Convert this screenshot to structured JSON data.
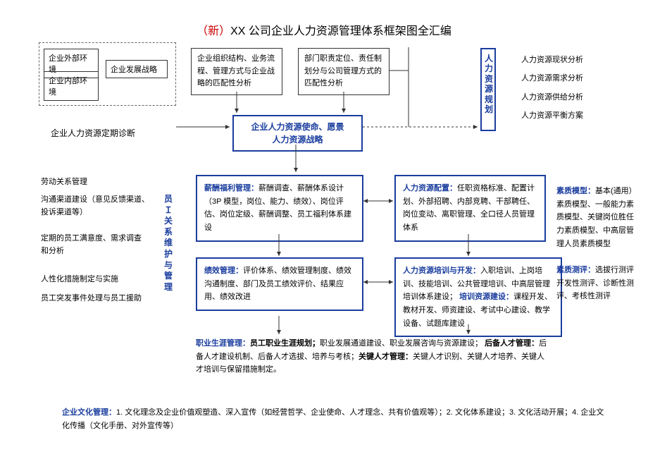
{
  "title": {
    "prefix": "（新）",
    "main": "XX 公司企业人力资源管理体系框架图全汇编"
  },
  "env": {
    "ext": "企业外部环境",
    "int": "企业内部环境",
    "strat": "企业发展战略"
  },
  "top": {
    "b1": "企业组织结构、业务流程、管理方式与企业战略的匹配性分析",
    "b2": "部门职责定位、责任制划分与公司管理方式的匹配性分析"
  },
  "center": {
    "l1": "企业人力资源使命、愿景",
    "l2": "人力资源战略"
  },
  "plan": "人力资源规划",
  "rightList": {
    "a": "人力资源现状分析",
    "b": "人力资源需求分析",
    "c": "人力资源供给分析",
    "d": "人力资源平衡方案"
  },
  "diag": "企业人力资源定期诊断",
  "mb1": {
    "head": "薪酬福利管理：",
    "body": "薪酬调查、薪酬体系设计（3P 模型，岗位、能力、绩效）、岗位评估、岗位定级、薪酬调整、员工福利体系建设"
  },
  "mb2": {
    "head": "人力资源配置：",
    "body": "任职资格标准、配置计划、外部招聘、内部竞聘、干部聘任、岗位变动、离职管理、全口径人员管理体系"
  },
  "mb3": {
    "head": "绩效管理：",
    "body": "评价体系、绩效管理制度、绩效沟通制度、部门及员工绩效评价、结果应用、绩效改进"
  },
  "mb4": {
    "h1": "人力资源培训与开发：",
    "b1": "入职培训、上岗培训、技能培训、公共管理培训、中高层管理培训体系建设；",
    "h2": "培训资源建设：",
    "b2": "课程开发、教材开发、师资建设、考试中心建设、教学设备、试题库建设"
  },
  "left": {
    "l1": "劳动关系管理",
    "l2": "沟通渠道建设（意见反馈渠道、投诉渠道等）",
    "l3": "定期的员工满意度、需求调查和分析",
    "l4": "人性化措施制定与实施",
    "l5": "员工突发事件处理与员工援助"
  },
  "vert": "员Ｉ关系维护与管理",
  "rd1": {
    "h": "素质模型：",
    "b": "基本(通用）素质模型、一般能力素质模型、关键岗位胜任力素质模型、中高层管理人员素质模型"
  },
  "rd2": {
    "h": "素质测评：",
    "b": "选拔行测评开发性测评、诊断性测评、考核性测评"
  },
  "career": {
    "h1": "职业生涯管理：",
    "s1": "员工职业生涯规划；",
    "b1": "职业发展通道建设、职业发展咨询与资源建设；",
    "h2": "后备人才管理：",
    "b2": "后备人才建设机制、后备人才选拔、培养与考核；",
    "h3": "关键人才管理：",
    "b3": "关键人才识别、关键人才培养、关键人才培训与保留措施制定。"
  },
  "culture": {
    "h": "企业文化管理：",
    "b": "1. 文化理念及企业价值观塑造、深入宣传（如经营哲学、企业使命、人才理念、共有价值观等）；2. 文化体系建设；3. 文化活动开展；4. 企业文化传播（文化手册、对外宣传等）"
  }
}
